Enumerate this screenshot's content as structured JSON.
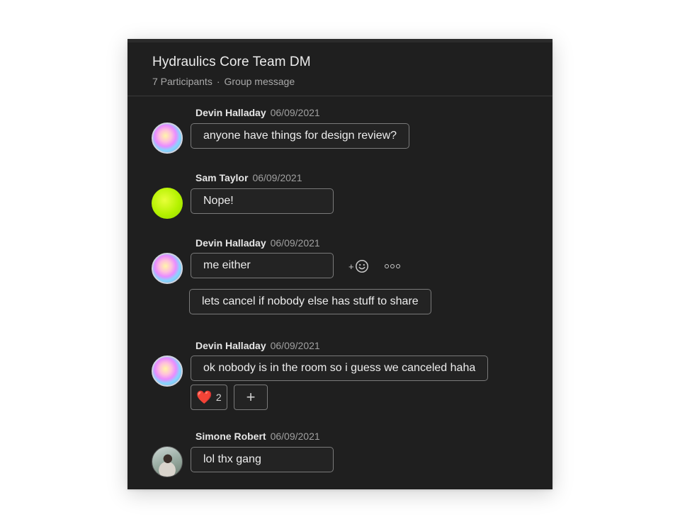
{
  "conversation": {
    "title": "Hydraulics Core Team DM",
    "participants": "7 Participants",
    "separator": "·",
    "type": "Group message"
  },
  "messages": [
    {
      "author": "Devin Halladay",
      "date": "06/09/2021",
      "bubbles": [
        "anyone have things for design review?"
      ]
    },
    {
      "author": "Sam Taylor",
      "date": "06/09/2021",
      "bubbles": [
        "Nope!"
      ]
    },
    {
      "author": "Devin Halladay",
      "date": "06/09/2021",
      "bubbles": [
        "me either",
        "lets cancel if nobody else has stuff to share"
      ]
    },
    {
      "author": "Devin Halladay",
      "date": "06/09/2021",
      "bubbles": [
        "ok nobody is in the room so i guess we canceled haha"
      ],
      "reactions": [
        {
          "emoji": "❤️",
          "icon": "heart-icon",
          "count": "2"
        }
      ],
      "add_reaction_label": "+"
    },
    {
      "author": "Simone Robert",
      "date": "06/09/2021",
      "bubbles": [
        "lol thx gang"
      ]
    }
  ],
  "hover_actions": {
    "add_reaction_icon": "add-emoji-icon",
    "more_icon": "more-options-icon"
  }
}
